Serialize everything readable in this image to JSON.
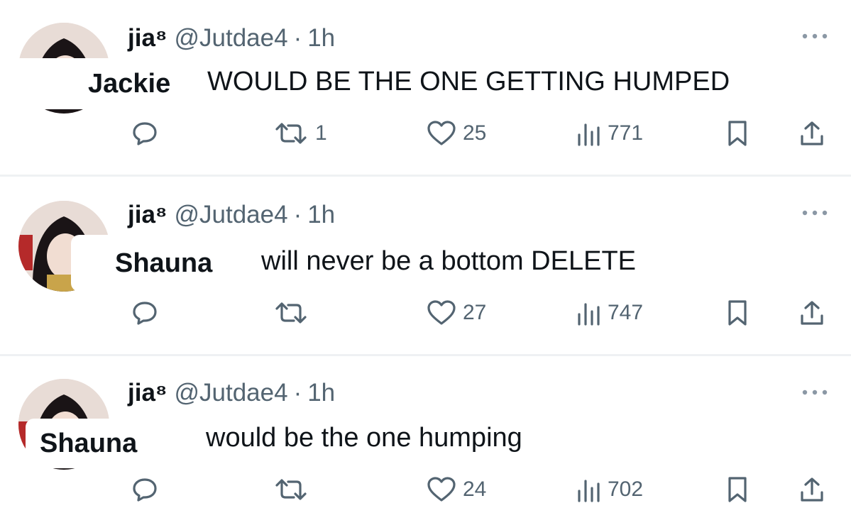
{
  "tweets": [
    {
      "display_name": "jia⁸",
      "handle": "@Jutdae4",
      "separator": "·",
      "time": "1h",
      "name_label": "Jackie",
      "text": "WOULD BE THE ONE GETTING HUMPED",
      "replies": "",
      "retweets": "1",
      "likes": "25",
      "views": "771"
    },
    {
      "display_name": "jia⁸",
      "handle": "@Jutdae4",
      "separator": "·",
      "time": "1h",
      "name_label": "Shauna",
      "text": "will never be a bottom DELETE",
      "replies": "",
      "retweets": "",
      "likes": "27",
      "views": "747"
    },
    {
      "display_name": "jia⁸",
      "handle": "@Jutdae4",
      "separator": "·",
      "time": "1h",
      "name_label": "Shauna",
      "text": "would be the one humping",
      "replies": "",
      "retweets": "",
      "likes": "24",
      "views": "702"
    }
  ],
  "icons": {
    "reply": "speech-bubble-icon",
    "retweet": "retweet-arrows-icon",
    "like": "heart-outline-icon",
    "views": "bar-chart-icon",
    "bookmark": "bookmark-icon",
    "share": "share-upload-icon",
    "more": "more-dots-icon"
  },
  "colors": {
    "text": "#0f1419",
    "secondary": "#536471",
    "divider": "#eff1f3",
    "background": "#ffffff"
  }
}
